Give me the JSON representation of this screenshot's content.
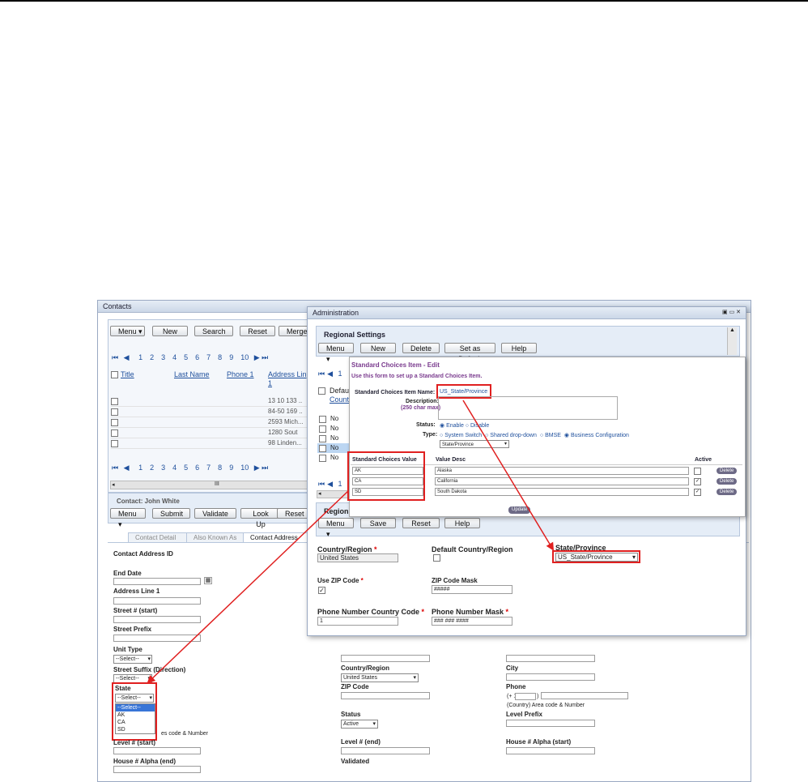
{
  "contacts": {
    "title": "Contacts",
    "toolbar": {
      "menu": "Menu",
      "new": "New",
      "search": "Search",
      "reset": "Reset",
      "merge": "Merge"
    },
    "pagination": [
      "1",
      "2",
      "3",
      "4",
      "5",
      "6",
      "7",
      "8",
      "9",
      "10"
    ],
    "columns": {
      "title": "Title",
      "last_name": "Last Name",
      "phone1": "Phone 1",
      "address_line": "Address Lin"
    },
    "address_line_sub": "1",
    "rows": [
      "13 10 133 ..",
      "84-50 169 ..",
      "2593 Mich...",
      "1280 Sout",
      "98 Linden..."
    ],
    "scroll_mark": "III"
  },
  "contact_panel": {
    "title": "Contact: John White",
    "toolbar": {
      "menu": "Menu",
      "submit": "Submit",
      "validate": "Validate",
      "lookup": "Look Up",
      "reset": "Reset"
    },
    "tabs": {
      "detail": "Contact Detail",
      "aka": "Also Known As",
      "address": "Contact Address"
    },
    "address_id_label": "Contact Address ID",
    "fields": {
      "end_date": "End Date",
      "address_line": "Address Line 1",
      "street_start": "Street # (start)",
      "street_prefix": "Street Prefix",
      "unit_type": "Unit Type",
      "unit_type_value": "--Select--",
      "street_suffix": "Street Suffix (Direction)",
      "street_suffix_value": "--Select--",
      "state": "State",
      "state_value": "--Select--",
      "state_options": [
        "--Select--",
        "AK",
        "CA",
        "SD"
      ],
      "area_code_text": "es code & Number",
      "level_start": "Level # (start)",
      "house_alpha_end": "House # Alpha (end)"
    },
    "right_fields": {
      "country": "Country/Region",
      "country_value": "United States",
      "city": "City",
      "zip": "ZIP Code",
      "phone": "Phone",
      "phone_prefix": "(+ 1",
      "phone_close": ")",
      "phone_hint": "(Country)   Area code & Number",
      "status": "Status",
      "status_value": "Active",
      "level_prefix": "Level Prefix",
      "level_end": "Level # (end)",
      "house_alpha_start": "House # Alpha (start)",
      "validated": "Validated"
    }
  },
  "admin": {
    "title": "Administration",
    "regional": {
      "title": "Regional Settings",
      "toolbar": {
        "menu": "Menu",
        "new": "New",
        "delete": "Delete",
        "set_default": "Set as Default",
        "help": "Help"
      },
      "pagination_first": "1",
      "default_col": "Defaul",
      "count_col": "Count",
      "rows": [
        "No",
        "No",
        "No",
        "No",
        "No"
      ],
      "region_label": "Regions",
      "toolbar2": {
        "menu": "Menu",
        "save": "Save",
        "reset": "Reset",
        "help": "Help"
      }
    },
    "standard_choices": {
      "title": "Standard Choices Item - Edit",
      "subtitle": "Use this form to set up a Standard Choices Item.",
      "name_label": "Standard Choices Item Name:",
      "name_value": "US_State/Province",
      "desc_label": "Description:",
      "desc_hint": "(250 char max)",
      "status_label": "Status:",
      "status_enable": "Enable",
      "status_disable": "Disable",
      "type_label": "Type:",
      "type_options": [
        "System Switch",
        "Shared drop-down",
        "BMSE",
        "Business Configuration"
      ],
      "type_select_value": "State/Province",
      "col_value": "Standard Choices Value",
      "col_desc": "Value Desc",
      "col_active": "Active",
      "rows": [
        {
          "value": "AK",
          "desc": "Alaska",
          "active": false
        },
        {
          "value": "CA",
          "desc": "California",
          "active": true
        },
        {
          "value": "SD",
          "desc": "South Dakota",
          "active": true
        }
      ],
      "delete_label": "Delete",
      "update_label": "Update"
    },
    "form": {
      "country_label": "Country/Region",
      "country_value": "United States",
      "default_country_label": "Default Country/Region",
      "state_label": "State/Province",
      "state_value": "US_State/Province",
      "use_zip_label": "Use ZIP Code",
      "zip_mask_label": "ZIP Code Mask",
      "zip_mask_value": "#####",
      "phone_cc_label": "Phone Number Country Code",
      "phone_cc_value": "1",
      "phone_mask_label": "Phone Number Mask",
      "phone_mask_value": "### ### ####"
    }
  },
  "colors": {
    "accent": "#1e4f9c",
    "highlight": "#e02020",
    "panel": "#e5edf7"
  }
}
